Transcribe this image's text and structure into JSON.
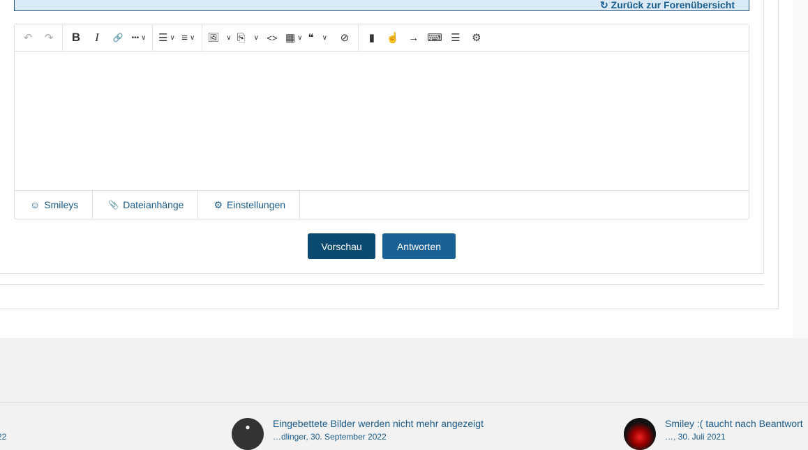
{
  "banner": {
    "back_link": "↻ Zurück zur Forenübersicht"
  },
  "toolbar": {
    "undo": "↶",
    "redo": "↷",
    "bold": "B",
    "italic": "I",
    "link": "🔗",
    "more": "•••",
    "list": "☰",
    "align": "≡",
    "image": "🖼",
    "spoiler": "⎘",
    "code": "<>",
    "table": "▦",
    "quote": "❝",
    "hide": "⊘",
    "book": "▮",
    "pointer": "☝",
    "arrow": "→",
    "keyboard": "⌨",
    "lines": "☰",
    "settings": "⚙",
    "chevron": "∨"
  },
  "tabs": [
    {
      "icon": "☺",
      "label": "Smileys"
    },
    {
      "icon": "📎",
      "label": "Dateianhänge"
    },
    {
      "icon": "⚙",
      "label": "Einstellungen"
    }
  ],
  "buttons": {
    "preview": "Vorschau",
    "reply": "Antworten"
  },
  "footer": {
    "left_fragment": "22",
    "items": [
      {
        "title": "Eingebettete Bilder werden nicht mehr angezeigt",
        "meta": "…dlinger, 30. September 2022"
      },
      {
        "title": "Smiley :( taucht nach Beantwort",
        "meta": "…, 30. Juli 2021"
      }
    ]
  },
  "colors": {
    "accent": "#1a5b8d",
    "primary_dark": "#0a4970",
    "primary": "#1a6295"
  }
}
